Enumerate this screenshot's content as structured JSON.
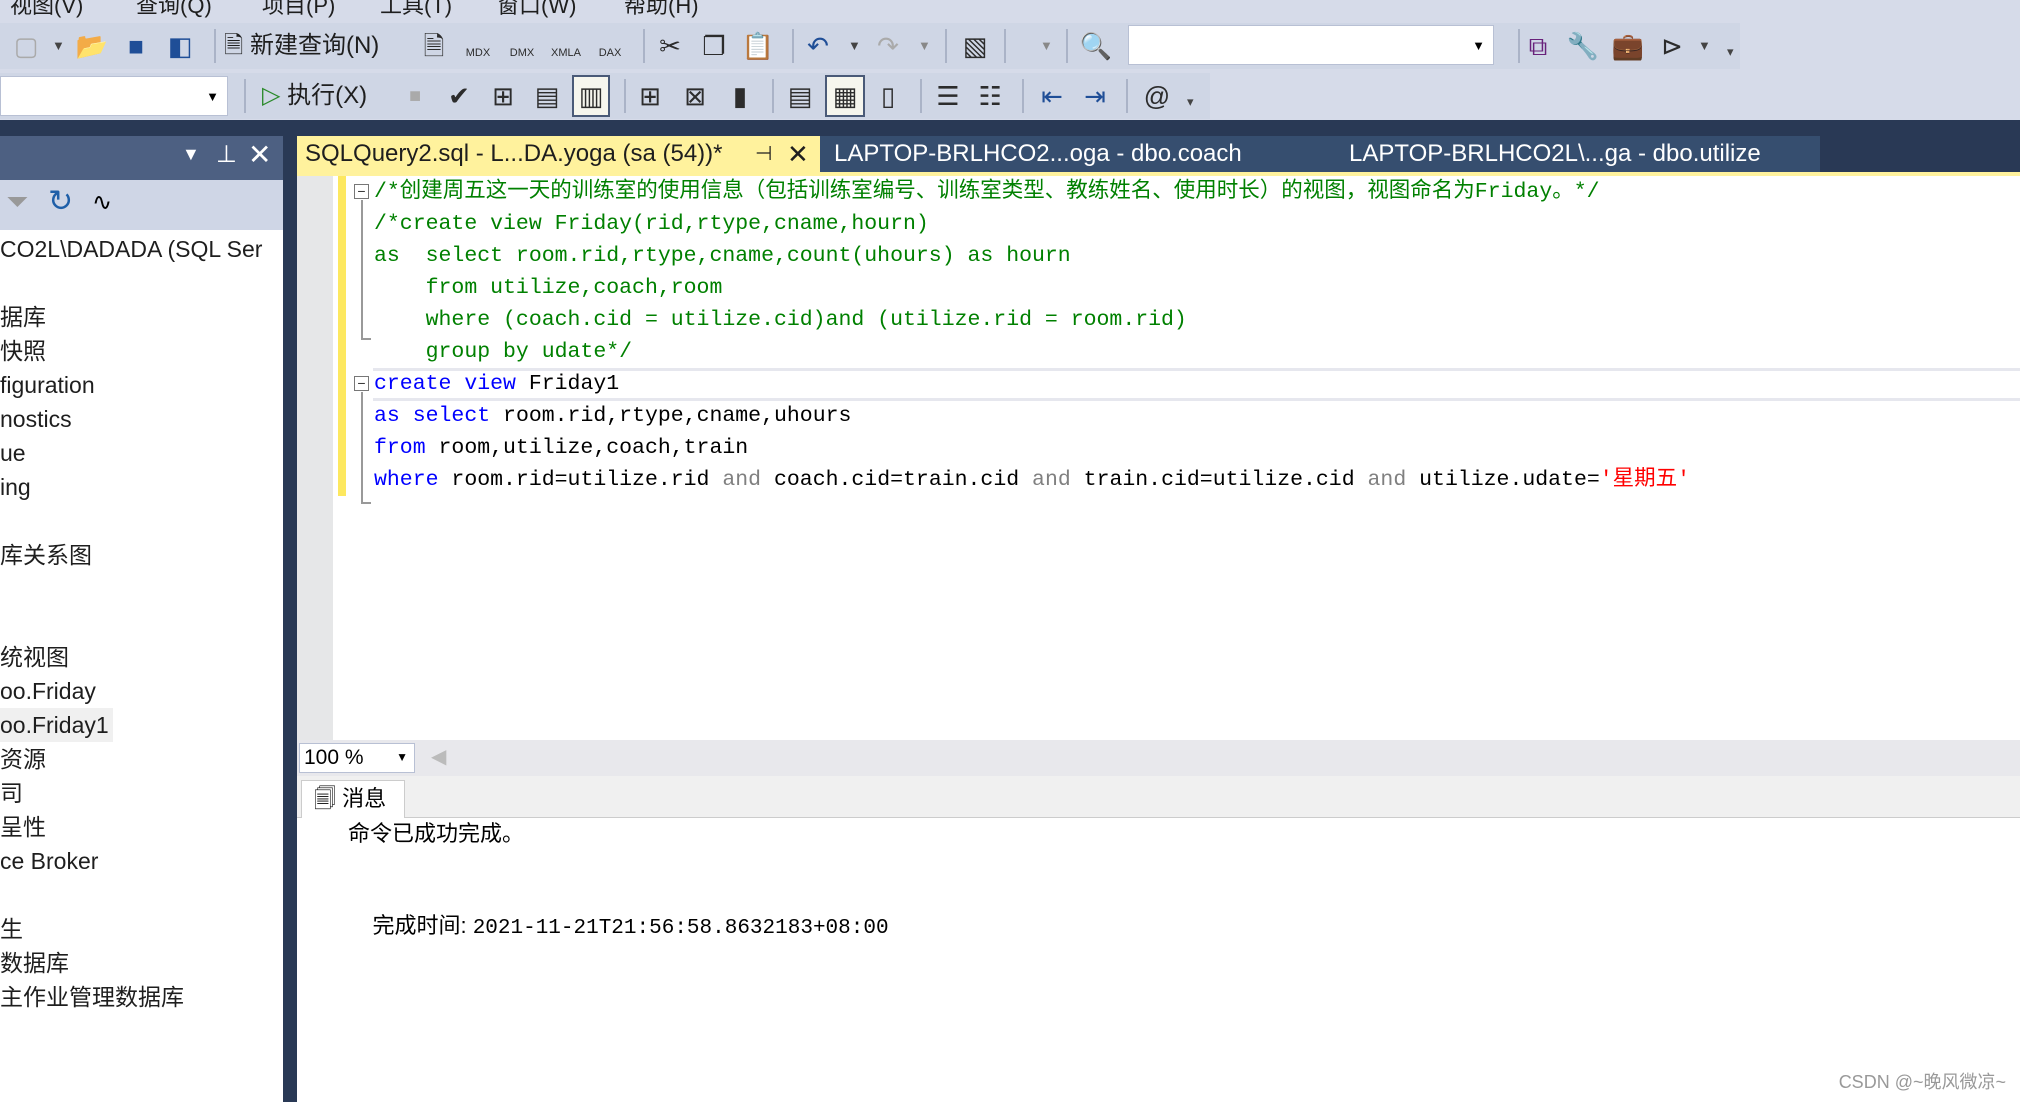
{
  "menu": [
    "视图(V)",
    "查询(Q)",
    "项目(P)",
    "工具(T)",
    "窗口(W)",
    "帮助(H)"
  ],
  "toolbar1": {
    "new_query": "新建查询(N)",
    "mdx": "MDX",
    "dmx": "DMX",
    "xmla": "XMLA",
    "dax": "DAX",
    "search_value": ""
  },
  "toolbar2": {
    "database_value": "",
    "execute": "执行(X)"
  },
  "sidebar": {
    "tree": [
      {
        "label": "CO2L\\DADADA (SQL Ser"
      },
      {
        "label": "据库"
      },
      {
        "label": "快照"
      },
      {
        "label": "figuration"
      },
      {
        "label": "nostics"
      },
      {
        "label": "ue"
      },
      {
        "label": "ing"
      },
      {
        "label": "库关系图"
      },
      {
        "label": "统视图"
      },
      {
        "label": "oo.Friday"
      },
      {
        "label": "oo.Friday1",
        "selected": true
      },
      {
        "label": "资源"
      },
      {
        "label": "司"
      },
      {
        "label": "呈性"
      },
      {
        "label": "ce Broker"
      },
      {
        "label": "生"
      },
      {
        "label": "数据库"
      },
      {
        "label": "主作业管理数据库"
      }
    ]
  },
  "tabs": [
    {
      "label": "SQLQuery2.sql - L...DA.yoga (sa (54))*",
      "active": true
    },
    {
      "label": "LAPTOP-BRLHCO2...oga - dbo.coach"
    },
    {
      "label": "LAPTOP-BRLHCO2L\\...ga - dbo.utilize"
    }
  ],
  "code": [
    [
      [
        "/*创建周五这一天的训练室的使用信息（包括训练室编号、训练室类型、教练姓名、使用时长）的视图，视图命名为Friday。*/",
        "c"
      ]
    ],
    [
      [
        "/*create view Friday(rid,rtype,cname,hourn)",
        "c"
      ]
    ],
    [
      [
        "as  select room.rid,rtype,cname,count(uhours) as hourn",
        "c"
      ]
    ],
    [
      [
        "    from utilize,coach,room",
        "c"
      ]
    ],
    [
      [
        "    where (coach.cid = utilize.cid)and (utilize.rid = room.rid)",
        "c"
      ]
    ],
    [
      [
        "    group by udate*/",
        "c"
      ]
    ],
    [
      [
        "create",
        "k"
      ],
      [
        " ",
        "n"
      ],
      [
        "view",
        "k"
      ],
      [
        " Friday1",
        "n"
      ]
    ],
    [
      [
        "as",
        "k"
      ],
      [
        " ",
        "n"
      ],
      [
        "select",
        "k"
      ],
      [
        " room.rid,rtype,cname,uhours",
        "n"
      ]
    ],
    [
      [
        "from",
        "k"
      ],
      [
        " room,utilize,coach,train",
        "n"
      ]
    ],
    [
      [
        "where",
        "k"
      ],
      [
        " room.rid=utilize.rid ",
        "n"
      ],
      [
        "and",
        "g"
      ],
      [
        " coach.cid=train.cid ",
        "n"
      ],
      [
        "and",
        "g"
      ],
      [
        " train.cid=utilize.cid ",
        "n"
      ],
      [
        "and",
        "g"
      ],
      [
        " utilize.udate=",
        "n"
      ],
      [
        "'星期五'",
        "s"
      ]
    ]
  ],
  "zoom": "100 %",
  "results": {
    "tab": "消息",
    "message": "命令已成功完成。",
    "time_label": "完成时间: ",
    "time_value": "2021-11-21T21:56:58.8632183+08:00"
  },
  "watermark": "CSDN @~晚风微凉~",
  "colors": {
    "comment": "#008000",
    "keyword": "#0000ff",
    "operator": "#808080",
    "string": "#ff0000",
    "active_tab": "#fff29d",
    "chrome_dark": "#293955"
  }
}
